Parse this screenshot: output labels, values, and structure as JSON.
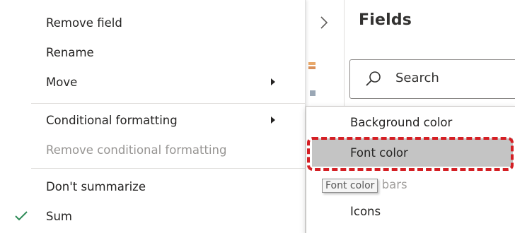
{
  "fields_pane": {
    "title": "Fields",
    "search_placeholder": "Search",
    "collapse_icon": "chevron-right-icon",
    "search_icon": "search-icon"
  },
  "context_menu": {
    "items": [
      {
        "label": "Remove field",
        "enabled": true,
        "has_submenu": false
      },
      {
        "label": "Rename",
        "enabled": true,
        "has_submenu": false
      },
      {
        "label": "Move",
        "enabled": true,
        "has_submenu": true
      },
      {
        "label": "Conditional formatting",
        "enabled": true,
        "has_submenu": true,
        "open": true
      },
      {
        "label": "Remove conditional formatting",
        "enabled": false,
        "has_submenu": false
      },
      {
        "label": "Don't summarize",
        "enabled": true,
        "has_submenu": false
      },
      {
        "label": "Sum",
        "enabled": true,
        "has_submenu": false,
        "checked": true
      }
    ],
    "check_icon": "checkmark-icon",
    "submenu_icon": "triangle-right-icon"
  },
  "submenu": {
    "items": [
      {
        "label": "Background color"
      },
      {
        "label": "Font color",
        "hovered": true
      },
      {
        "label": "Data bars"
      },
      {
        "label": "Icons"
      }
    ],
    "tooltip": "Font color"
  },
  "colors": {
    "highlight_border": "#d41f24",
    "hover_background": "#c4c4c4",
    "check": "#2e8b57",
    "disabled_text": "#979593"
  }
}
